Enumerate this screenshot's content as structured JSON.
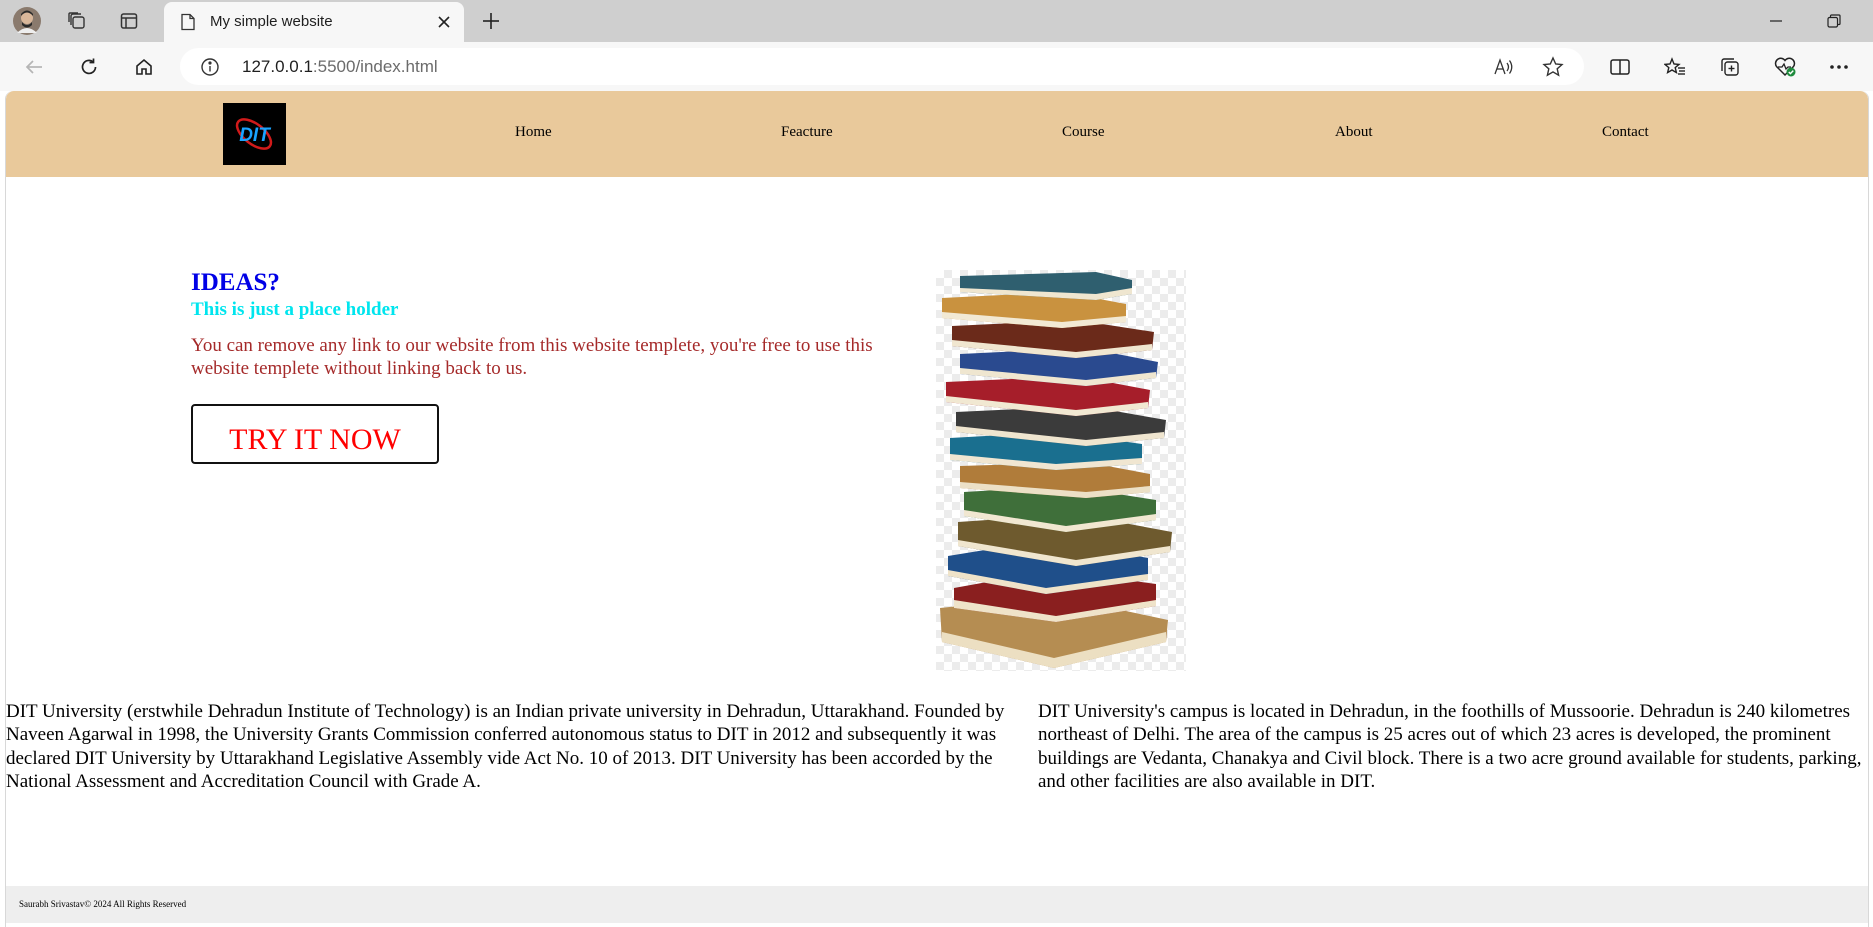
{
  "browser": {
    "tab_title": "My simple website",
    "address": {
      "host": "127.0.0.1",
      "path": ":5500/index.html"
    }
  },
  "site": {
    "logo_text": "DIT",
    "nav": [
      "Home",
      "Feacture",
      "Course",
      "About",
      "Contact"
    ],
    "hero": {
      "title": "IDEAS?",
      "subtitle": "This is just a place holder",
      "description": "You can remove any link to our website from this website templete, you're free to use this website templete without linking back to us.",
      "button_label": "TRY IT NOW"
    },
    "paragraphs": {
      "left": "DIT University (erstwhile Dehradun Institute of Technology) is an Indian private university in Dehradun, Uttarakhand. Founded by Naveen Agarwal in 1998, the University Grants Commission conferred autonomous status to DIT in 2012 and subsequently it was declared DIT University by Uttarakhand Legislative Assembly vide Act No. 10 of 2013. DIT University has been accorded by the National Assessment and Accreditation Council with Grade A.",
      "right": "DIT University's campus is located in Dehradun, in the foothills of Mussoorie. Dehradun is 240 kilometres northeast of Delhi. The area of the campus is 25 acres out of which 23 acres is developed, the prominent buildings are Vedanta, Chanakya and Civil block. There is a two acre ground available for students, parking, and other facilities are also available in DIT."
    },
    "footer": "Saurabh Srivastav© 2024 All Rights Reserved"
  },
  "colors": {
    "navbar": "#e9c99b",
    "hero_title": "#0000e6",
    "hero_subtitle": "#00e5ee",
    "hero_desc": "#a52a2a",
    "button_text": "#ff0000"
  },
  "icons": [
    "profile-avatar",
    "workspaces-icon",
    "tab-actions-icon",
    "page-icon",
    "close-icon",
    "plus-icon",
    "minimize-icon",
    "restore-icon",
    "back-icon",
    "refresh-icon",
    "home-icon",
    "info-icon",
    "read-aloud-icon",
    "favorite-star-icon",
    "split-screen-icon",
    "favorites-icon",
    "collections-icon",
    "browser-essentials-icon",
    "more-icon"
  ]
}
